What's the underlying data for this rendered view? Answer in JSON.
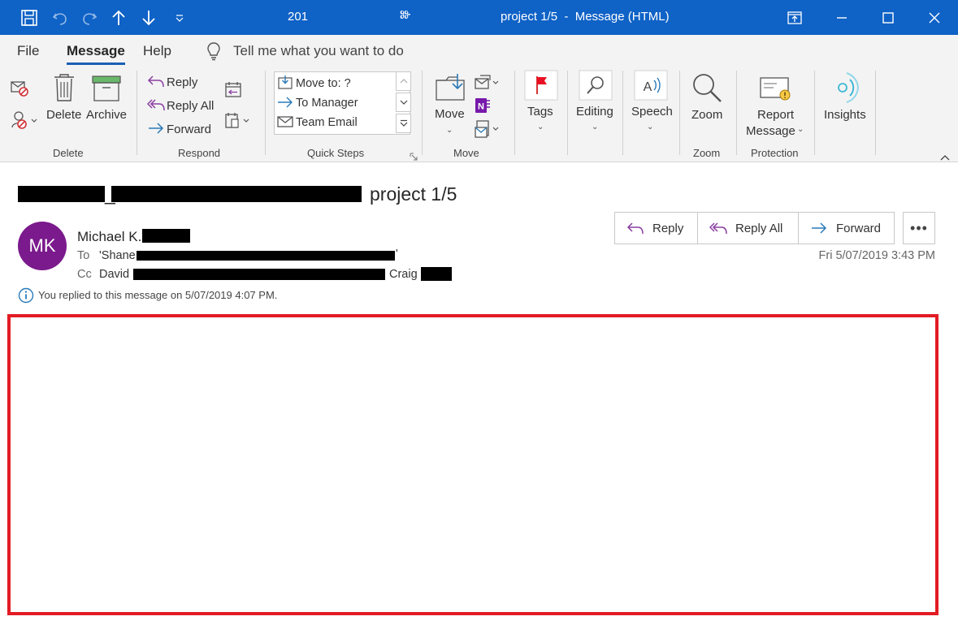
{
  "titlebar": {
    "number": "201",
    "mark": "Ⱆ",
    "title": "project 1/5  -  Message (HTML)"
  },
  "tabs": [
    {
      "label": "File"
    },
    {
      "label": "Message"
    },
    {
      "label": "Help"
    }
  ],
  "tell_me": "Tell me what you want to do",
  "ribbon": {
    "delete_group": {
      "delete": "Delete",
      "archive": "Archive",
      "label": "Delete"
    },
    "respond_group": {
      "reply": "Reply",
      "reply_all": "Reply All",
      "forward": "Forward",
      "label": "Respond"
    },
    "quick_steps": {
      "items": [
        "Move to: ?",
        "To Manager",
        "Team Email"
      ],
      "label": "Quick Steps"
    },
    "move_group": {
      "move": "Move",
      "label": "Move"
    },
    "tags": "Tags",
    "editing": "Editing",
    "speech": "Speech",
    "zoom_group": {
      "zoom": "Zoom",
      "label": "Zoom"
    },
    "protection_group": {
      "report_line1": "Report",
      "report_line2": "Message",
      "label": "Protection"
    },
    "insights": "Insights"
  },
  "message": {
    "subject_suffix": "project 1/5",
    "subject_visible_prefix": "_",
    "sender_initials": "MK",
    "sender_name": "Michael K.",
    "to_label": "To",
    "to_value": "'Shane",
    "to_tail": "'",
    "cc_label": "Cc",
    "cc_value": "David",
    "cc_value2": "Craig",
    "date": "Fri 5/07/2019 3:43 PM",
    "info": "You replied to this message on 5/07/2019 4:07 PM."
  },
  "actions": {
    "reply": "Reply",
    "reply_all": "Reply All",
    "forward": "Forward",
    "more": "•••"
  },
  "colors": {
    "titlebar": "#0f62c6",
    "avatar": "#7b1a8c",
    "highlight": "#e21b23",
    "accent_blue": "#1a5fb4"
  }
}
